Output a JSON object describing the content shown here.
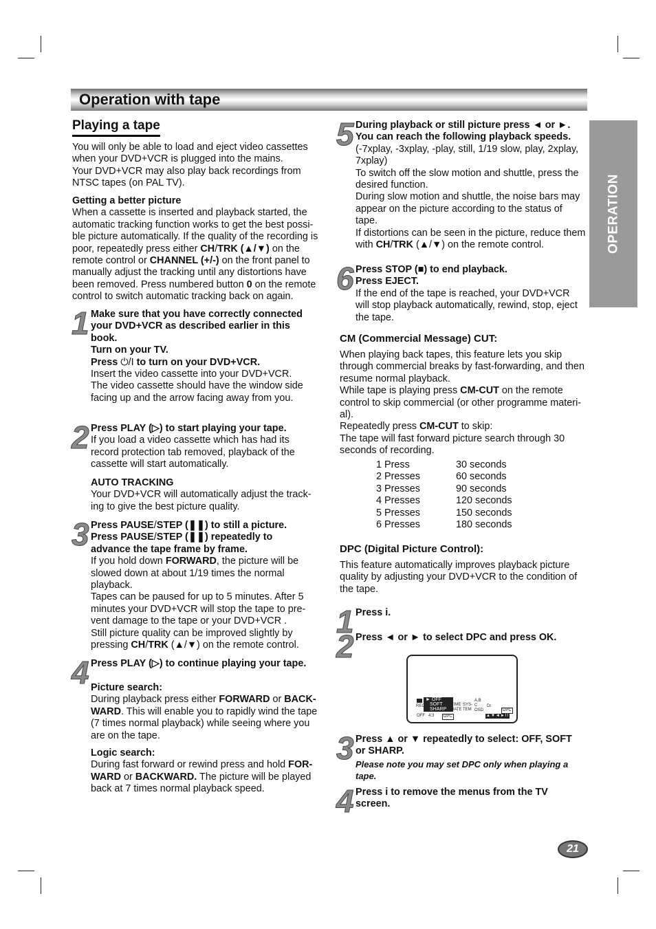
{
  "header": {
    "title": "Operation with tape"
  },
  "side_tab": "OPERATION",
  "page_number": "21",
  "left": {
    "section_title": "Playing a tape",
    "intro": [
      [
        {
          "t": "You will only be able to load and eject video cassettes when your DVD+VCR is plugged into the mains."
        }
      ],
      [
        {
          "t": "Your DVD+VCR may also play back recordings from NTSC tapes (on PAL TV)."
        }
      ]
    ],
    "better": [
      [
        {
          "t": "Getting a better picture",
          "b": true
        }
      ],
      [
        {
          "t": "When a cassette is inserted and playback started, the automatic tracking function works to get the best possi-ble picture automatically. If the quality of the recording is poor, repeatedly press either "
        },
        {
          "t": "CH",
          "b": true
        },
        {
          "t": "/"
        },
        {
          "t": "TRK (▲/▼)",
          "b": true
        },
        {
          "t": " on the remote control or "
        },
        {
          "t": "CHANNEL (+/-)",
          "b": true
        },
        {
          "t": " on the front panel  to manually adjust the tracking until any distortions have been removed. Press numbered button "
        },
        {
          "t": "0",
          "b": true
        },
        {
          "t": " on the remote control to switch automatic tracking back on again."
        }
      ]
    ],
    "steps": [
      {
        "n": "1",
        "paras": [
          [
            {
              "t": "Make sure that you have correctly connected your DVD+VCR as described earlier in this book.",
              "b": true
            }
          ],
          [
            {
              "t": "Turn on your TV.",
              "b": true
            }
          ],
          [
            {
              "t": "Press ",
              "b": true
            },
            {
              "t": " ⏻/I ",
              "b": false
            },
            {
              "t": "to turn on your DVD+VCR.",
              "b": true
            }
          ],
          [
            {
              "t": "Insert the video cassette into your DVD+VCR."
            }
          ],
          [
            {
              "t": "The video cassette should have the window side facing up and the arrow facing away from you."
            }
          ]
        ]
      },
      {
        "n": "2",
        "paras": [
          [
            {
              "t": "Press PLAY (▷) to start playing your tape.",
              "b": true
            }
          ],
          [
            {
              "t": "If you load a video cassette which has had its record protection tab removed, playback of the cassette will start automatically."
            }
          ]
        ]
      },
      {
        "n": "3",
        "paras": [
          [
            {
              "t": "Press PAUSE",
              "b": true
            },
            {
              "t": "/"
            },
            {
              "t": "STEP (❚❚) to still a picture.",
              "b": true
            }
          ],
          [
            {
              "t": "Press PAUSE",
              "b": true
            },
            {
              "t": "/"
            },
            {
              "t": "STEP (❚❚) repeatedly to advance the tape frame by frame.",
              "b": true
            }
          ],
          [
            {
              "t": "If you hold down "
            },
            {
              "t": "FORWARD",
              "b": true
            },
            {
              "t": ", the picture will be slowed down at about 1/19 times the normal playback."
            }
          ],
          [
            {
              "t": "Tapes can be paused for up to 5 minutes. After 5 minutes your DVD+VCR will stop the tape to pre-vent damage to the tape or your DVD+VCR ."
            }
          ],
          [
            {
              "t": "Still picture quality can be improved slightly by pressing "
            },
            {
              "t": "CH",
              "b": true
            },
            {
              "t": "/"
            },
            {
              "t": "TRK",
              "b": true
            },
            {
              "t": " (▲/▼) on the remote control."
            }
          ]
        ]
      },
      {
        "n": "4",
        "paras": [
          [
            {
              "t": "Press PLAY (▷) to continue playing your tape.",
              "b": true
            }
          ]
        ]
      }
    ],
    "auto_tracking": [
      [
        {
          "t": "AUTO TRACKING",
          "b": true
        }
      ],
      [
        {
          "t": "Your DVD+VCR will automatically adjust the track-ing to give the best picture quality."
        }
      ]
    ],
    "picture_search": [
      [
        {
          "t": "Picture search:",
          "b": true
        }
      ],
      [
        {
          "t": "During playback press either "
        },
        {
          "t": "FORWARD",
          "b": true
        },
        {
          "t": " or "
        },
        {
          "t": "BACK-WARD",
          "b": true
        },
        {
          "t": ". This will enable you to rapidly wind the tape (7 times normal playback) while seeing where you are on the tape."
        }
      ]
    ],
    "logic_search": [
      [
        {
          "t": "Logic search:",
          "b": true
        }
      ],
      [
        {
          "t": "During fast forward or rewind press and hold "
        },
        {
          "t": "FOR-WARD",
          "b": true
        },
        {
          "t": " or "
        },
        {
          "t": "BACKWARD.",
          "b": true
        },
        {
          "t": " The picture will be played back at 7 times normal playback speed."
        }
      ]
    ]
  },
  "right": {
    "steps_a": [
      {
        "n": "5",
        "paras": [
          [
            {
              "t": "During playback or still picture press ◄ or ►. You can reach the following playback speeds.",
              "b": true
            }
          ],
          [
            {
              "t": "(-7xplay, -3xplay, -play, still, 1/19 slow, play, 2xplay, 7xplay)"
            }
          ],
          [
            {
              "t": "To switch off the slow motion and shuttle, press the desired function."
            }
          ],
          [
            {
              "t": "During slow motion and shuttle, the noise bars may appear on the picture according to the status of tape."
            }
          ],
          [
            {
              "t": "If distortions can be seen in the picture, reduce them with "
            },
            {
              "t": "CH",
              "b": true
            },
            {
              "t": "/"
            },
            {
              "t": "TRK",
              "b": true
            },
            {
              "t": " (▲/▼) on the remote control."
            }
          ]
        ]
      },
      {
        "n": "6",
        "paras": [
          [
            {
              "t": "Press STOP (■) to end playback.",
              "b": true
            }
          ],
          [
            {
              "t": "Press EJECT.",
              "b": true
            }
          ],
          [
            {
              "t": "If the end of the tape is reached, your DVD+VCR will stop playback automatically, rewind, stop, eject the tape."
            }
          ]
        ]
      }
    ],
    "cm_title": "CM (Commercial Message) CUT:",
    "cm": [
      [
        {
          "t": "When playing back tapes, this feature lets you skip through commercial breaks by fast-forwarding, and then resume normal playback."
        }
      ],
      [
        {
          "t": "While tape is playing press "
        },
        {
          "t": "CM-CUT",
          "b": true
        },
        {
          "t": " on the remote control to skip commercial (or other programme materi-al)."
        }
      ],
      [
        {
          "t": "Repeatedly press "
        },
        {
          "t": "CM-CUT",
          "b": true
        },
        {
          "t": " to skip:"
        }
      ],
      [
        {
          "t": "The tape will fast forward picture search through 30 seconds of recording."
        }
      ]
    ],
    "cm_table": [
      [
        "1 Press",
        "30 seconds"
      ],
      [
        "2 Presses",
        "60 seconds"
      ],
      [
        "3 Presses",
        "90 seconds"
      ],
      [
        "4 Presses",
        "120 seconds"
      ],
      [
        "5 Presses",
        "150 seconds"
      ],
      [
        "6 Presses",
        "180 seconds"
      ]
    ],
    "dpc_title": "DPC (Digital Picture Control):",
    "dpc": [
      [
        {
          "t": "This feature automatically improves playback picture quality by adjusting your DVD+VCR to the condition of the tape."
        }
      ]
    ],
    "dpc_steps": [
      {
        "n": "1",
        "paras": [
          [
            {
              "t": "Press i.",
              "b": true
            }
          ]
        ]
      },
      {
        "n": "2",
        "paras": [
          [
            {
              "t": "Press ◄ or ► to select DPC and press OK.",
              "b": true
            }
          ]
        ]
      },
      {
        "n": "3",
        "paras": [
          [
            {
              "t": "Press ▲ or ▼ repeatedly to select: OFF, SOFT or SHARP.",
              "b": true
            }
          ]
        ],
        "note": "Please note you may set DPC only when playing a tape."
      },
      {
        "n": "4",
        "paras": [
          [
            {
              "t": "Press i to remove the menus from the TV screen.",
              "b": true
            }
          ]
        ]
      }
    ],
    "osd": {
      "menu": [
        "► OFF",
        "SOFT",
        "SHARP"
      ],
      "labels": [
        "REC",
        "OFF",
        "4:3",
        "DPC",
        "TIME DATE",
        "SYS-TEM",
        "A,B C",
        "OSD",
        "Dr.",
        "DPC"
      ],
      "nav": "▲▼◄►II"
    }
  }
}
